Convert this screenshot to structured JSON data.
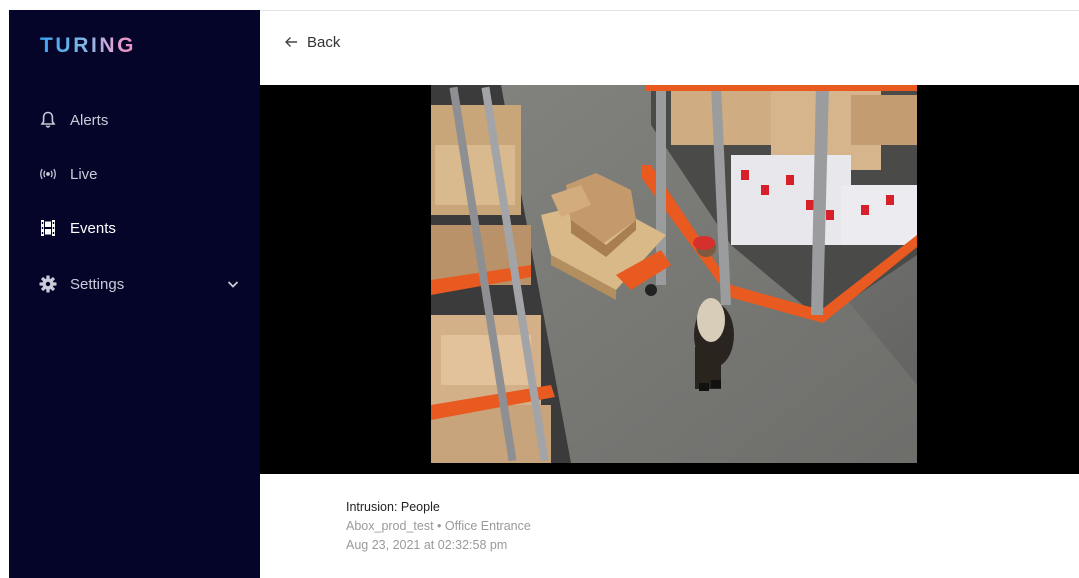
{
  "app": {
    "logo": "TURING"
  },
  "sidebar": {
    "items": [
      {
        "label": "Alerts",
        "icon": "bell-icon"
      },
      {
        "label": "Live",
        "icon": "broadcast-icon"
      },
      {
        "label": "Events",
        "icon": "film-icon",
        "active": true
      },
      {
        "label": "Settings",
        "icon": "gear-icon",
        "expandable": true
      }
    ]
  },
  "header": {
    "back_label": "Back"
  },
  "event": {
    "title": "Intrusion: People",
    "location": "Abox_prod_test • Office Entrance",
    "timestamp": "Aug 23, 2021 at 02:32:58 pm"
  },
  "colors": {
    "sidebar_bg": "#05052a",
    "media_bg": "#000000",
    "rack_orange": "#e85a20"
  }
}
